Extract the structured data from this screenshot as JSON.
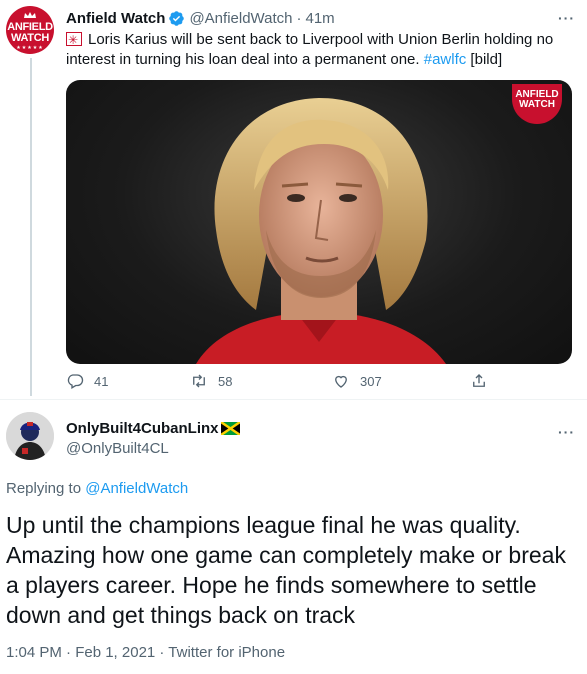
{
  "original_tweet": {
    "author_name": "Anfield Watch",
    "handle": "@AnfieldWatch",
    "separator": "·",
    "time": "41m",
    "text_main": "Loris Karius will be sent back to Liverpool with Union Berlin holding no interest in turning his loan deal into a permanent one. ",
    "hashtag": "#awlfc",
    "text_tail": " [bild]",
    "avatar_logo_line1": "ANFIELD",
    "avatar_logo_line2": "WATCH",
    "media_badge_line1": "ANFIELD",
    "media_badge_line2": "WATCH",
    "stats": {
      "replies": "41",
      "retweets": "58",
      "likes": "307"
    }
  },
  "reply_tweet": {
    "author_name": "OnlyBuilt4CubanLinx",
    "handle": "@OnlyBuilt4CL",
    "replying_prefix": "Replying to ",
    "replying_to": "@AnfieldWatch",
    "text": "Up until the champions league final he was quality. Amazing how one game can completely make or break a players career. Hope he finds somewhere to settle down and get things back on track",
    "timestamp": "1:04 PM · Feb 1, 2021 · Twitter for iPhone"
  },
  "colors": {
    "accent": "#1d9bf0",
    "brand_red": "#c8102e",
    "secondary_text": "#536471"
  }
}
